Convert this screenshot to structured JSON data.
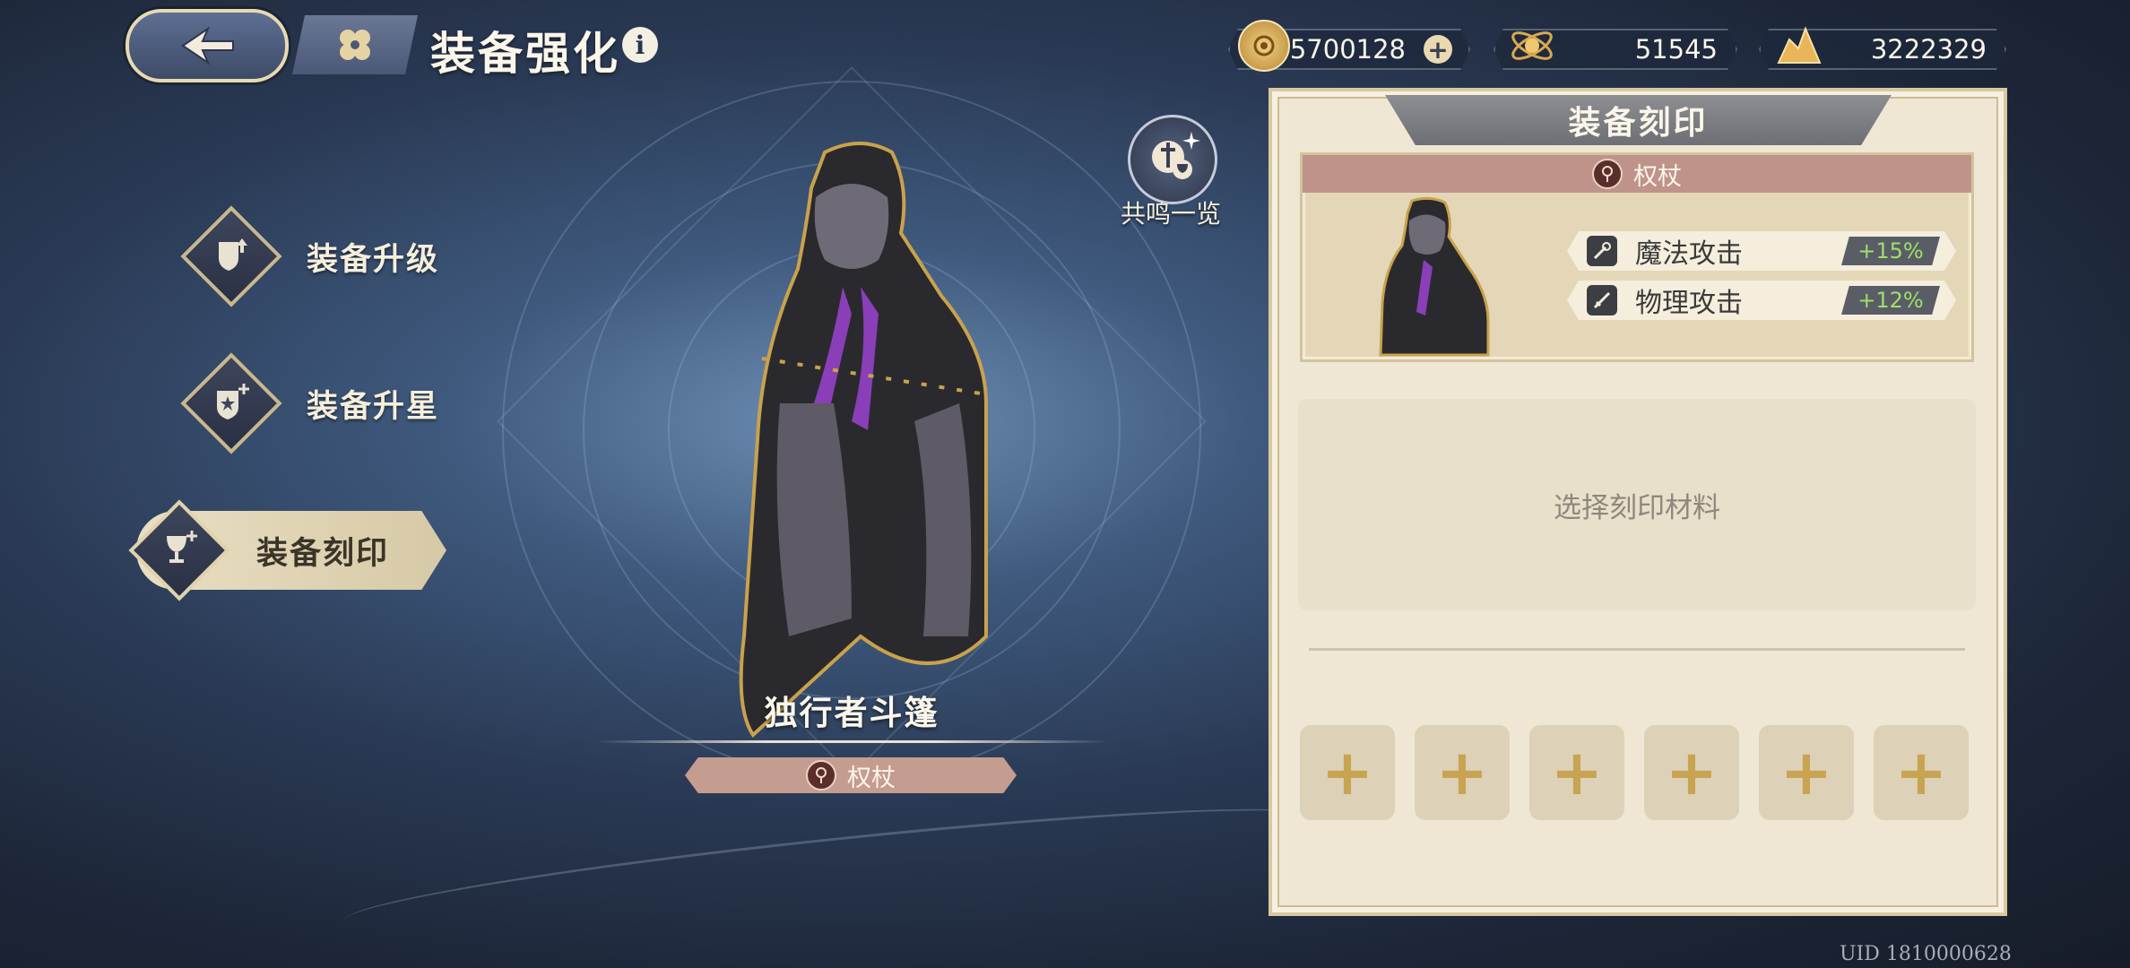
{
  "header": {
    "title": "装备强化",
    "back_icon": "back-arrow-icon",
    "home_icon": "clover-icon"
  },
  "currencies": [
    {
      "icon": "gold-coin-icon",
      "value": "5700128",
      "has_add": true
    },
    {
      "icon": "atom-crystal-icon",
      "value": "51545",
      "has_add": false
    },
    {
      "icon": "gold-pile-icon",
      "value": "3222329",
      "has_add": false
    }
  ],
  "menu": {
    "items": [
      {
        "label": "装备升级",
        "icon": "shield-up-icon",
        "active": false
      },
      {
        "label": "装备升星",
        "icon": "shield-star-icon",
        "active": false
      },
      {
        "label": "装备刻印",
        "icon": "chalice-plus-icon",
        "active": true
      }
    ]
  },
  "equipment": {
    "name": "独行者斗篷",
    "type": "权杖",
    "resonance_label": "共鸣一览"
  },
  "panel": {
    "title": "装备刻印",
    "card_type": "权杖",
    "stats": [
      {
        "name": "魔法攻击",
        "value": "+15%",
        "icon": "wand-icon"
      },
      {
        "name": "物理攻击",
        "value": "+12%",
        "icon": "sword-icon"
      }
    ],
    "select_prompt": "选择刻印材料",
    "slots": [
      "+",
      "+",
      "+",
      "+",
      "+",
      "+"
    ]
  },
  "footer": {
    "uid": "UID 1810000628"
  },
  "colors": {
    "accent_gold": "#c8a452",
    "stat_green": "#9ee06a",
    "tag_rose": "#c0938a"
  }
}
